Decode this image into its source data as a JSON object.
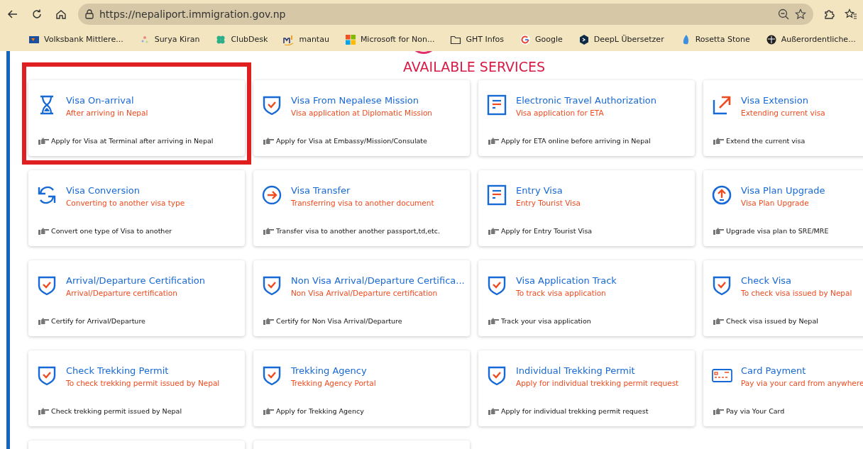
{
  "browser": {
    "url": "https://nepaliport.immigration.gov.np",
    "bookmarks": [
      {
        "label": "Volksbank Mittlere..."
      },
      {
        "label": "Surya Kiran"
      },
      {
        "label": "ClubDesk"
      },
      {
        "label": "mantau"
      },
      {
        "label": "Microsoft for Non..."
      },
      {
        "label": "GHT Infos"
      },
      {
        "label": "Google"
      },
      {
        "label": "DeepL Übersetzer"
      },
      {
        "label": "Rosetta Stone"
      },
      {
        "label": "Außerordentliche..."
      }
    ]
  },
  "heading": "AVAILABLE SERVICES",
  "services": [
    {
      "title": "Visa On-arrival",
      "subtitle": "After arriving in Nepal",
      "action": "Apply for Visa at Terminal after arriving in Nepal",
      "kind": "hourglass",
      "highlighted": true
    },
    {
      "title": "Visa From Nepalese Mission",
      "subtitle": "Visa application at Diplomatic Mission",
      "action": "Apply for Visa at Embassy/Mission/Consulate",
      "kind": "shield",
      "highlighted": false
    },
    {
      "title": "Electronic Travel Authorization",
      "subtitle": "Visa application for ETA",
      "action": "Apply for ETA online before arriving in Nepal",
      "kind": "document",
      "highlighted": false
    },
    {
      "title": "Visa Extension",
      "subtitle": "Extending current visa",
      "action": "Extend the current visa",
      "kind": "extend",
      "highlighted": false
    },
    {
      "title": "Visa Conversion",
      "subtitle": "Converting to another visa type",
      "action": "Convert one type of Visa to another",
      "kind": "convert",
      "highlighted": false
    },
    {
      "title": "Visa Transfer",
      "subtitle": "Transferring visa to another document",
      "action": "Transfer visa to another another passport,td,etc.",
      "kind": "transfer",
      "highlighted": false
    },
    {
      "title": "Entry Visa",
      "subtitle": "Entry Tourist Visa",
      "action": "Apply for Entry Tourist Visa",
      "kind": "document",
      "highlighted": false
    },
    {
      "title": "Visa Plan Upgrade",
      "subtitle": "Visa Plan Upgrade",
      "action": "Upgrade visa plan to SRE/MRE",
      "kind": "upgrade",
      "highlighted": false
    },
    {
      "title": "Arrival/Departure Certification",
      "subtitle": "Arrival/Departure certification",
      "action": "Certify for Arrival/Departure",
      "kind": "shield",
      "highlighted": false
    },
    {
      "title": "Non Visa Arrival/Departure Certifica...",
      "subtitle": "Non Visa Arrival/Departure certification",
      "action": "Certify for Non Visa Arrival/Departure",
      "kind": "shield",
      "highlighted": false
    },
    {
      "title": "Visa Application Track",
      "subtitle": "To track visa application",
      "action": "Track your visa application",
      "kind": "shield",
      "highlighted": false
    },
    {
      "title": "Check Visa",
      "subtitle": "To check visa issued by Nepal",
      "action": "Check visa issued by Nepal",
      "kind": "shield",
      "highlighted": false
    },
    {
      "title": "Check Trekking Permit",
      "subtitle": "To check trekking permit issued by Nepal",
      "action": "Check trekking permit issued by Nepal",
      "kind": "shield",
      "highlighted": false
    },
    {
      "title": "Trekking Agency",
      "subtitle": "Trekking Agency Portal",
      "action": "Apply for Trekking Agency",
      "kind": "shield",
      "highlighted": false
    },
    {
      "title": "Individual Trekking Permit",
      "subtitle": "Apply for individual trekking permit request",
      "action": "Apply for individual trekking permit request",
      "kind": "shield",
      "highlighted": false
    },
    {
      "title": "Card Payment",
      "subtitle": "Pay via your card from anywhere",
      "action": "Pay via Your Card",
      "kind": "card",
      "highlighted": false
    }
  ]
}
